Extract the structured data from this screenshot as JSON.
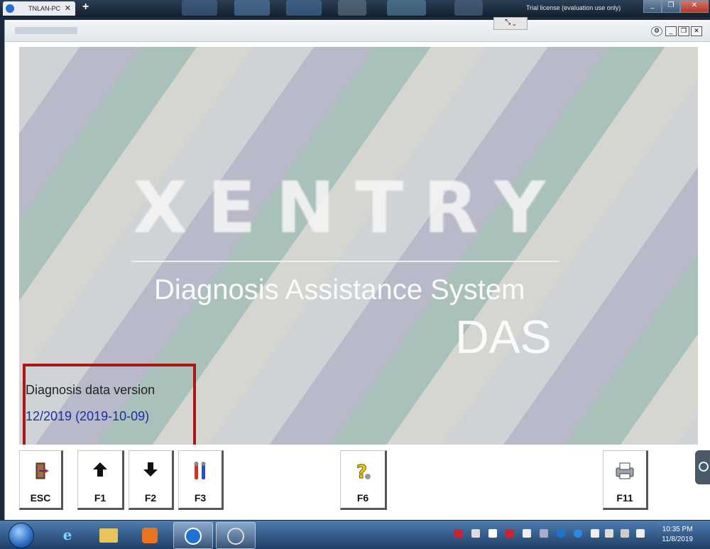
{
  "remote_bar": {
    "tab_label": "TNLAN-PC",
    "tab_close": "✕",
    "new_tab": "+",
    "license_text": "Trial license (evaluation use only)"
  },
  "window": {
    "minimize": "_",
    "restore": "❐",
    "close": "✕"
  },
  "splash": {
    "logo_text": "XENTRY",
    "subtitle": "Diagnosis Assistance System",
    "short_name": "DAS",
    "data_version_label": "Diagnosis data version",
    "data_version_value": "12/2019 (2019-10-09)"
  },
  "function_keys": [
    {
      "label": "ESC",
      "icon": "exit-door-icon"
    },
    {
      "label": "F1",
      "icon": "arrow-up-icon"
    },
    {
      "label": "F2",
      "icon": "arrow-down-icon"
    },
    {
      "label": "F3",
      "icon": "tools-icon"
    },
    {
      "label": "F6",
      "icon": "help-question-icon"
    },
    {
      "label": "F11",
      "icon": "printer-icon"
    }
  ],
  "taskbar": {
    "time": "10:35 PM",
    "date": "11/8/2019"
  },
  "colors": {
    "highlight_box": "#b01515",
    "version_value": "#1a2fa3"
  }
}
